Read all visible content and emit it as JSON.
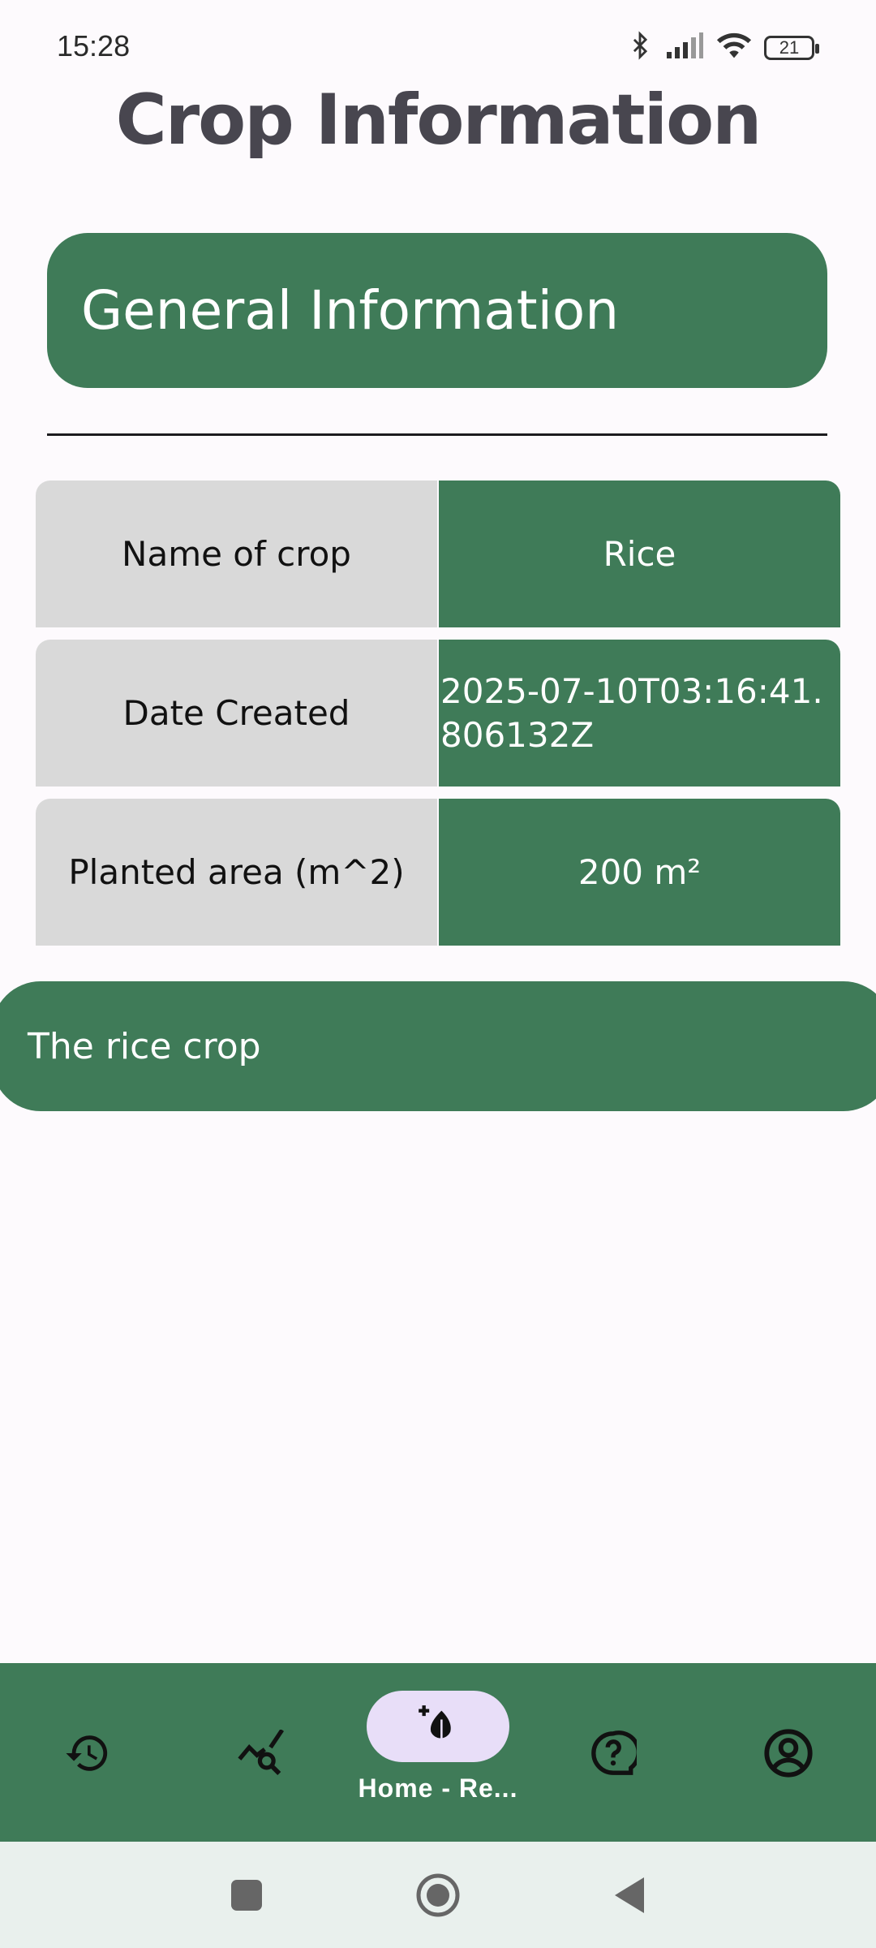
{
  "status_bar": {
    "time": "15:28",
    "battery_level": "21"
  },
  "page": {
    "title": "Crop Information"
  },
  "section": {
    "title": "General Information"
  },
  "details": [
    {
      "label": "Name of crop",
      "value": "Rice"
    },
    {
      "label": "Date Created",
      "value": "2025-07-10T03:16:41.806132Z"
    },
    {
      "label": "Planted area (m^2)",
      "value": "200 m²"
    }
  ],
  "description": "The rice crop",
  "bottom_nav": {
    "items": [
      {
        "icon": "history-icon"
      },
      {
        "icon": "chart-search-icon"
      },
      {
        "icon": "add-crop-icon",
        "label": "Home - Re...",
        "active": true
      },
      {
        "icon": "help-icon"
      },
      {
        "icon": "account-icon"
      }
    ]
  },
  "colors": {
    "primary": "#3f7b58",
    "active_pill": "#e8def8",
    "label_cell": "#d9d9d9",
    "background": "#fdfafd"
  }
}
